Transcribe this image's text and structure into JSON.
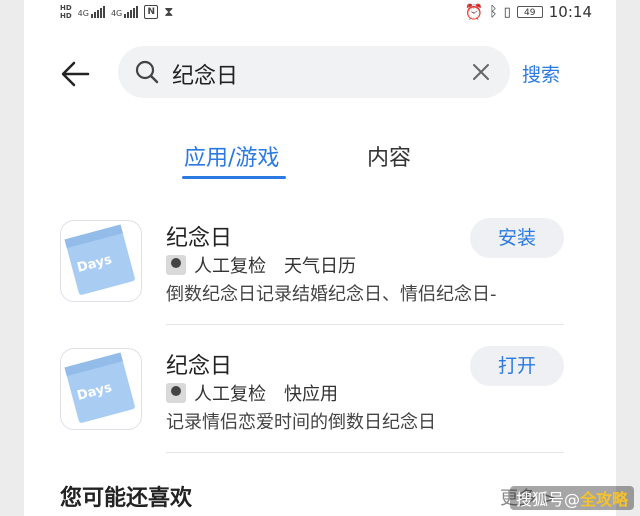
{
  "status": {
    "left_icons": [
      "hd-icon",
      "signal-4g-icon",
      "hd-icon",
      "signal-4g-icon",
      "nfc-icon",
      "hourglass-icon"
    ],
    "signal_label": "4G",
    "right_icons": [
      "alarm-icon",
      "bluetooth-icon",
      "vibrate-icon"
    ],
    "battery": "49",
    "time": "10:14"
  },
  "search": {
    "query": "纪念日",
    "button": "搜索"
  },
  "tabs": [
    {
      "label": "应用/游戏",
      "active": true
    },
    {
      "label": "内容",
      "active": false
    }
  ],
  "apps": [
    {
      "icon_text": "Days",
      "name": "纪念日",
      "developer": "人工复检",
      "category": "天气日历",
      "description": "倒数纪念日记录结婚纪念日、情侣纪念日-",
      "action": "安装"
    },
    {
      "icon_text": "Days",
      "name": "纪念日",
      "developer": "人工复检",
      "category": "快应用",
      "description": "记录情侣恋爱时间的倒数日纪念日",
      "action": "打开"
    }
  ],
  "section": {
    "title": "您可能还喜欢",
    "more": "更多 >"
  },
  "watermark": {
    "prefix": "搜狐号@",
    "brand": "全攻略"
  },
  "colors": {
    "accent": "#2a7ae2",
    "icon_bg": "#a9cdf2"
  }
}
